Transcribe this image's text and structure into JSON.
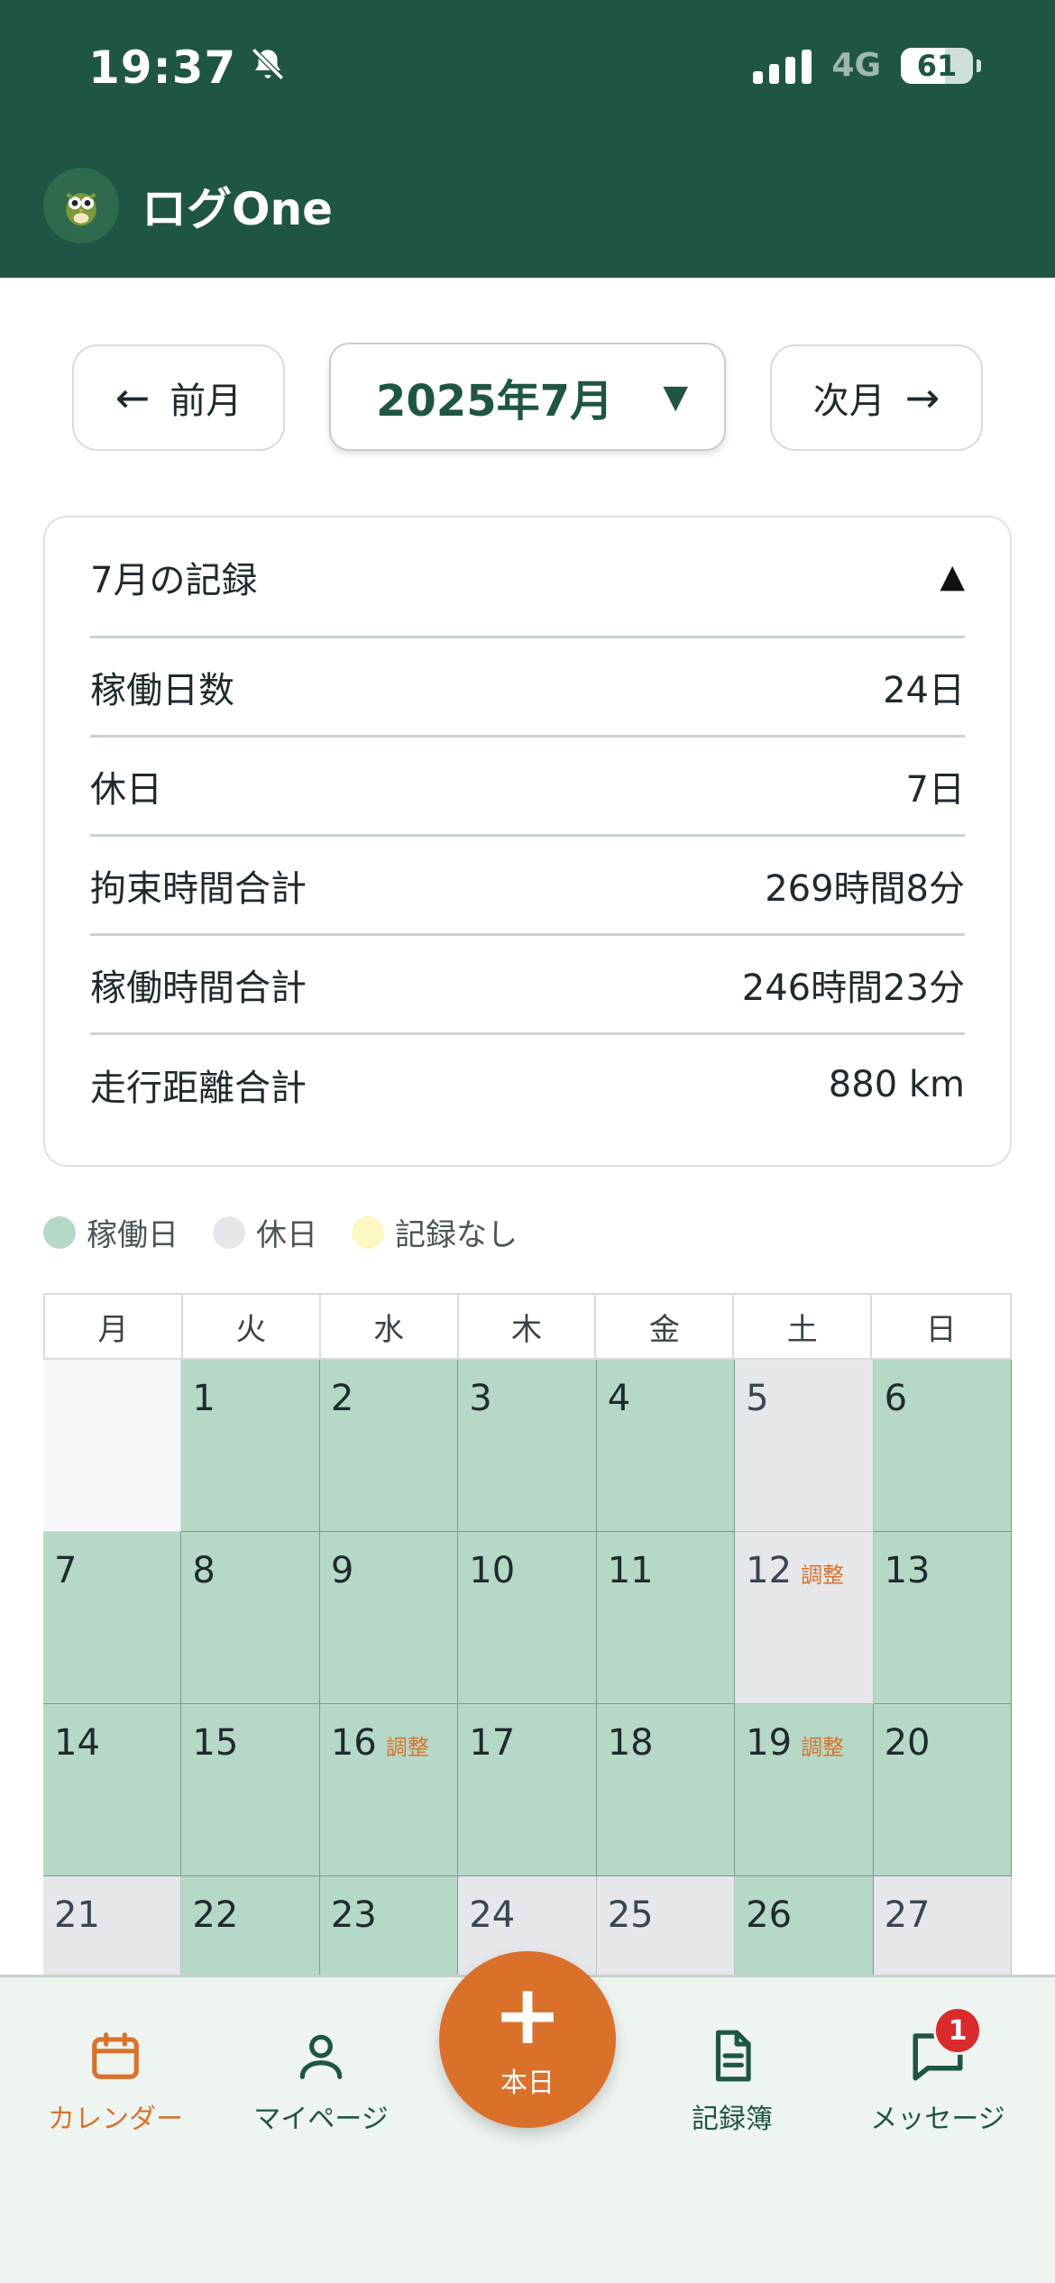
{
  "status_bar": {
    "time": "19:37",
    "network": "4G",
    "battery": "61",
    "battery_level": 0.61
  },
  "app": {
    "title": "ログOne"
  },
  "month_nav": {
    "prev_label": "前月",
    "prev_arrow": "←",
    "next_label": "次月",
    "next_arrow": "→",
    "current_month": "2025年7月",
    "dropdown_caret": "▼"
  },
  "summary": {
    "title": "7月の記録",
    "toggle": "▲",
    "rows": [
      {
        "label": "稼働日数",
        "value": "24日"
      },
      {
        "label": "休日",
        "value": "7日"
      },
      {
        "label": "拘束時間合計",
        "value": "269時間8分"
      },
      {
        "label": "稼働時間合計",
        "value": "246時間23分"
      },
      {
        "label": "走行距離合計",
        "value": "880 km"
      }
    ]
  },
  "legend": {
    "items": [
      {
        "label": "稼働日",
        "color": "#b6d8c6"
      },
      {
        "label": "休日",
        "color": "#e6e7eb"
      },
      {
        "label": "記録なし",
        "color": "#fdf7c3"
      }
    ]
  },
  "calendar": {
    "weekdays": [
      "月",
      "火",
      "水",
      "木",
      "金",
      "土",
      "日"
    ],
    "adjust_label": "調整",
    "weeks": [
      [
        {
          "day": "",
          "type": "empty",
          "tag": ""
        },
        {
          "day": "1",
          "type": "work",
          "tag": ""
        },
        {
          "day": "2",
          "type": "work",
          "tag": ""
        },
        {
          "day": "3",
          "type": "work",
          "tag": ""
        },
        {
          "day": "4",
          "type": "work",
          "tag": ""
        },
        {
          "day": "5",
          "type": "off",
          "tag": ""
        },
        {
          "day": "6",
          "type": "work",
          "tag": ""
        }
      ],
      [
        {
          "day": "7",
          "type": "work",
          "tag": ""
        },
        {
          "day": "8",
          "type": "work",
          "tag": ""
        },
        {
          "day": "9",
          "type": "work",
          "tag": ""
        },
        {
          "day": "10",
          "type": "work",
          "tag": ""
        },
        {
          "day": "11",
          "type": "work",
          "tag": ""
        },
        {
          "day": "12",
          "type": "off",
          "tag": "調整"
        },
        {
          "day": "13",
          "type": "work",
          "tag": ""
        }
      ],
      [
        {
          "day": "14",
          "type": "work",
          "tag": ""
        },
        {
          "day": "15",
          "type": "work",
          "tag": ""
        },
        {
          "day": "16",
          "type": "work",
          "tag": "調整"
        },
        {
          "day": "17",
          "type": "work",
          "tag": ""
        },
        {
          "day": "18",
          "type": "work",
          "tag": ""
        },
        {
          "day": "19",
          "type": "work",
          "tag": "調整"
        },
        {
          "day": "20",
          "type": "work",
          "tag": ""
        }
      ],
      [
        {
          "day": "21",
          "type": "off",
          "tag": ""
        },
        {
          "day": "22",
          "type": "work",
          "tag": ""
        },
        {
          "day": "23",
          "type": "work",
          "tag": ""
        },
        {
          "day": "24",
          "type": "off",
          "tag": ""
        },
        {
          "day": "25",
          "type": "off",
          "tag": ""
        },
        {
          "day": "26",
          "type": "work",
          "tag": ""
        },
        {
          "day": "27",
          "type": "off",
          "tag": ""
        }
      ]
    ]
  },
  "tabbar": {
    "tabs": [
      {
        "label": "カレンダー",
        "icon": "calendar-icon",
        "active": true
      },
      {
        "label": "マイページ",
        "icon": "person-icon",
        "active": false
      },
      {
        "label": "記録簿",
        "icon": "document-icon",
        "active": false
      },
      {
        "label": "メッセージ",
        "icon": "chat-icon",
        "active": false,
        "badge": "1"
      }
    ],
    "fab_plus": "+",
    "fab_label": "本日"
  },
  "colors": {
    "brand": "#1e5545",
    "accent": "#d9712b",
    "work_day": "#b6d8c6",
    "off_day": "#e6e7eb",
    "badge": "#d92b2b"
  }
}
